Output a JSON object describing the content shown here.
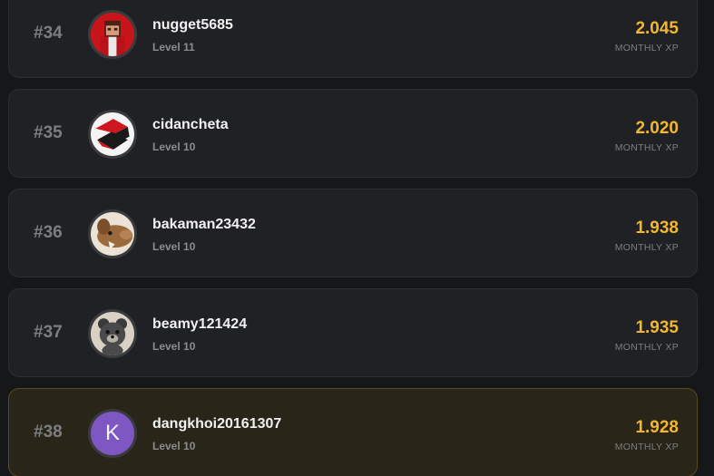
{
  "leaderboard": [
    {
      "rank": "#34",
      "username": "nugget5685",
      "level": "Level 11",
      "xp": "2.045",
      "xp_label": "MONTHLY XP",
      "avatar_icon": "red-character-avatar-icon"
    },
    {
      "rank": "#35",
      "username": "cidancheta",
      "level": "Level 10",
      "xp": "2.020",
      "xp_label": "MONTHLY XP",
      "avatar_icon": "red-black-logo-avatar-icon"
    },
    {
      "rank": "#36",
      "username": "bakaman23432",
      "level": "Level 10",
      "xp": "1.938",
      "xp_label": "MONTHLY XP",
      "avatar_icon": "dog-avatar-icon"
    },
    {
      "rank": "#37",
      "username": "beamy121424",
      "level": "Level 10",
      "xp": "1.935",
      "xp_label": "MONTHLY XP",
      "avatar_icon": "bear-avatar-icon"
    },
    {
      "rank": "#38",
      "username": "dangkhoi20161307",
      "level": "Level 10",
      "xp": "1.928",
      "xp_label": "MONTHLY XP",
      "avatar_icon": "letter-avatar-icon",
      "avatar_letter": "K",
      "highlighted": true
    }
  ],
  "colors": {
    "accent_xp": "#f2b630",
    "highlight_bg": "#2a2519",
    "letter_avatar_bg": "#7e57c2"
  }
}
